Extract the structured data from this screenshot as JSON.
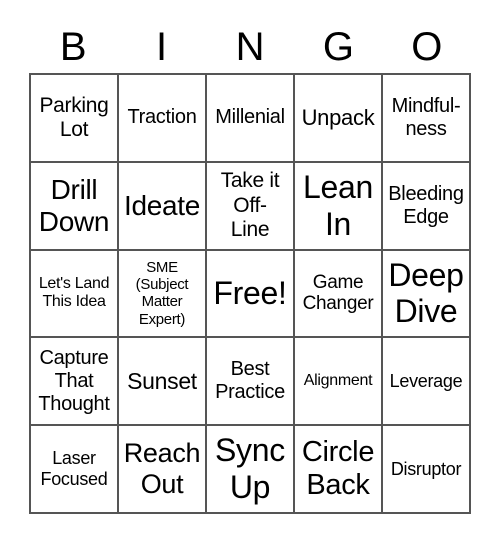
{
  "header": [
    "B",
    "I",
    "N",
    "G",
    "O"
  ],
  "cells": [
    "Parking\nLot",
    "Traction",
    "Millenial",
    "Unpack",
    "Mindful-\nness",
    "Drill\nDown",
    "Ideate",
    "Take it\nOff-\nLine",
    "Lean\nIn",
    "Bleeding\nEdge",
    "Let's Land\nThis Idea",
    "SME\n(Subject\nMatter\nExpert)",
    "Free!",
    "Game\nChanger",
    "Deep\nDive",
    "Capture\nThat\nThought",
    "Sunset",
    "Best\nPractice",
    "Alignment",
    "Leverage",
    "Laser\nFocused",
    "Reach\nOut",
    "Sync\nUp",
    "Circle\nBack",
    "Disruptor"
  ]
}
